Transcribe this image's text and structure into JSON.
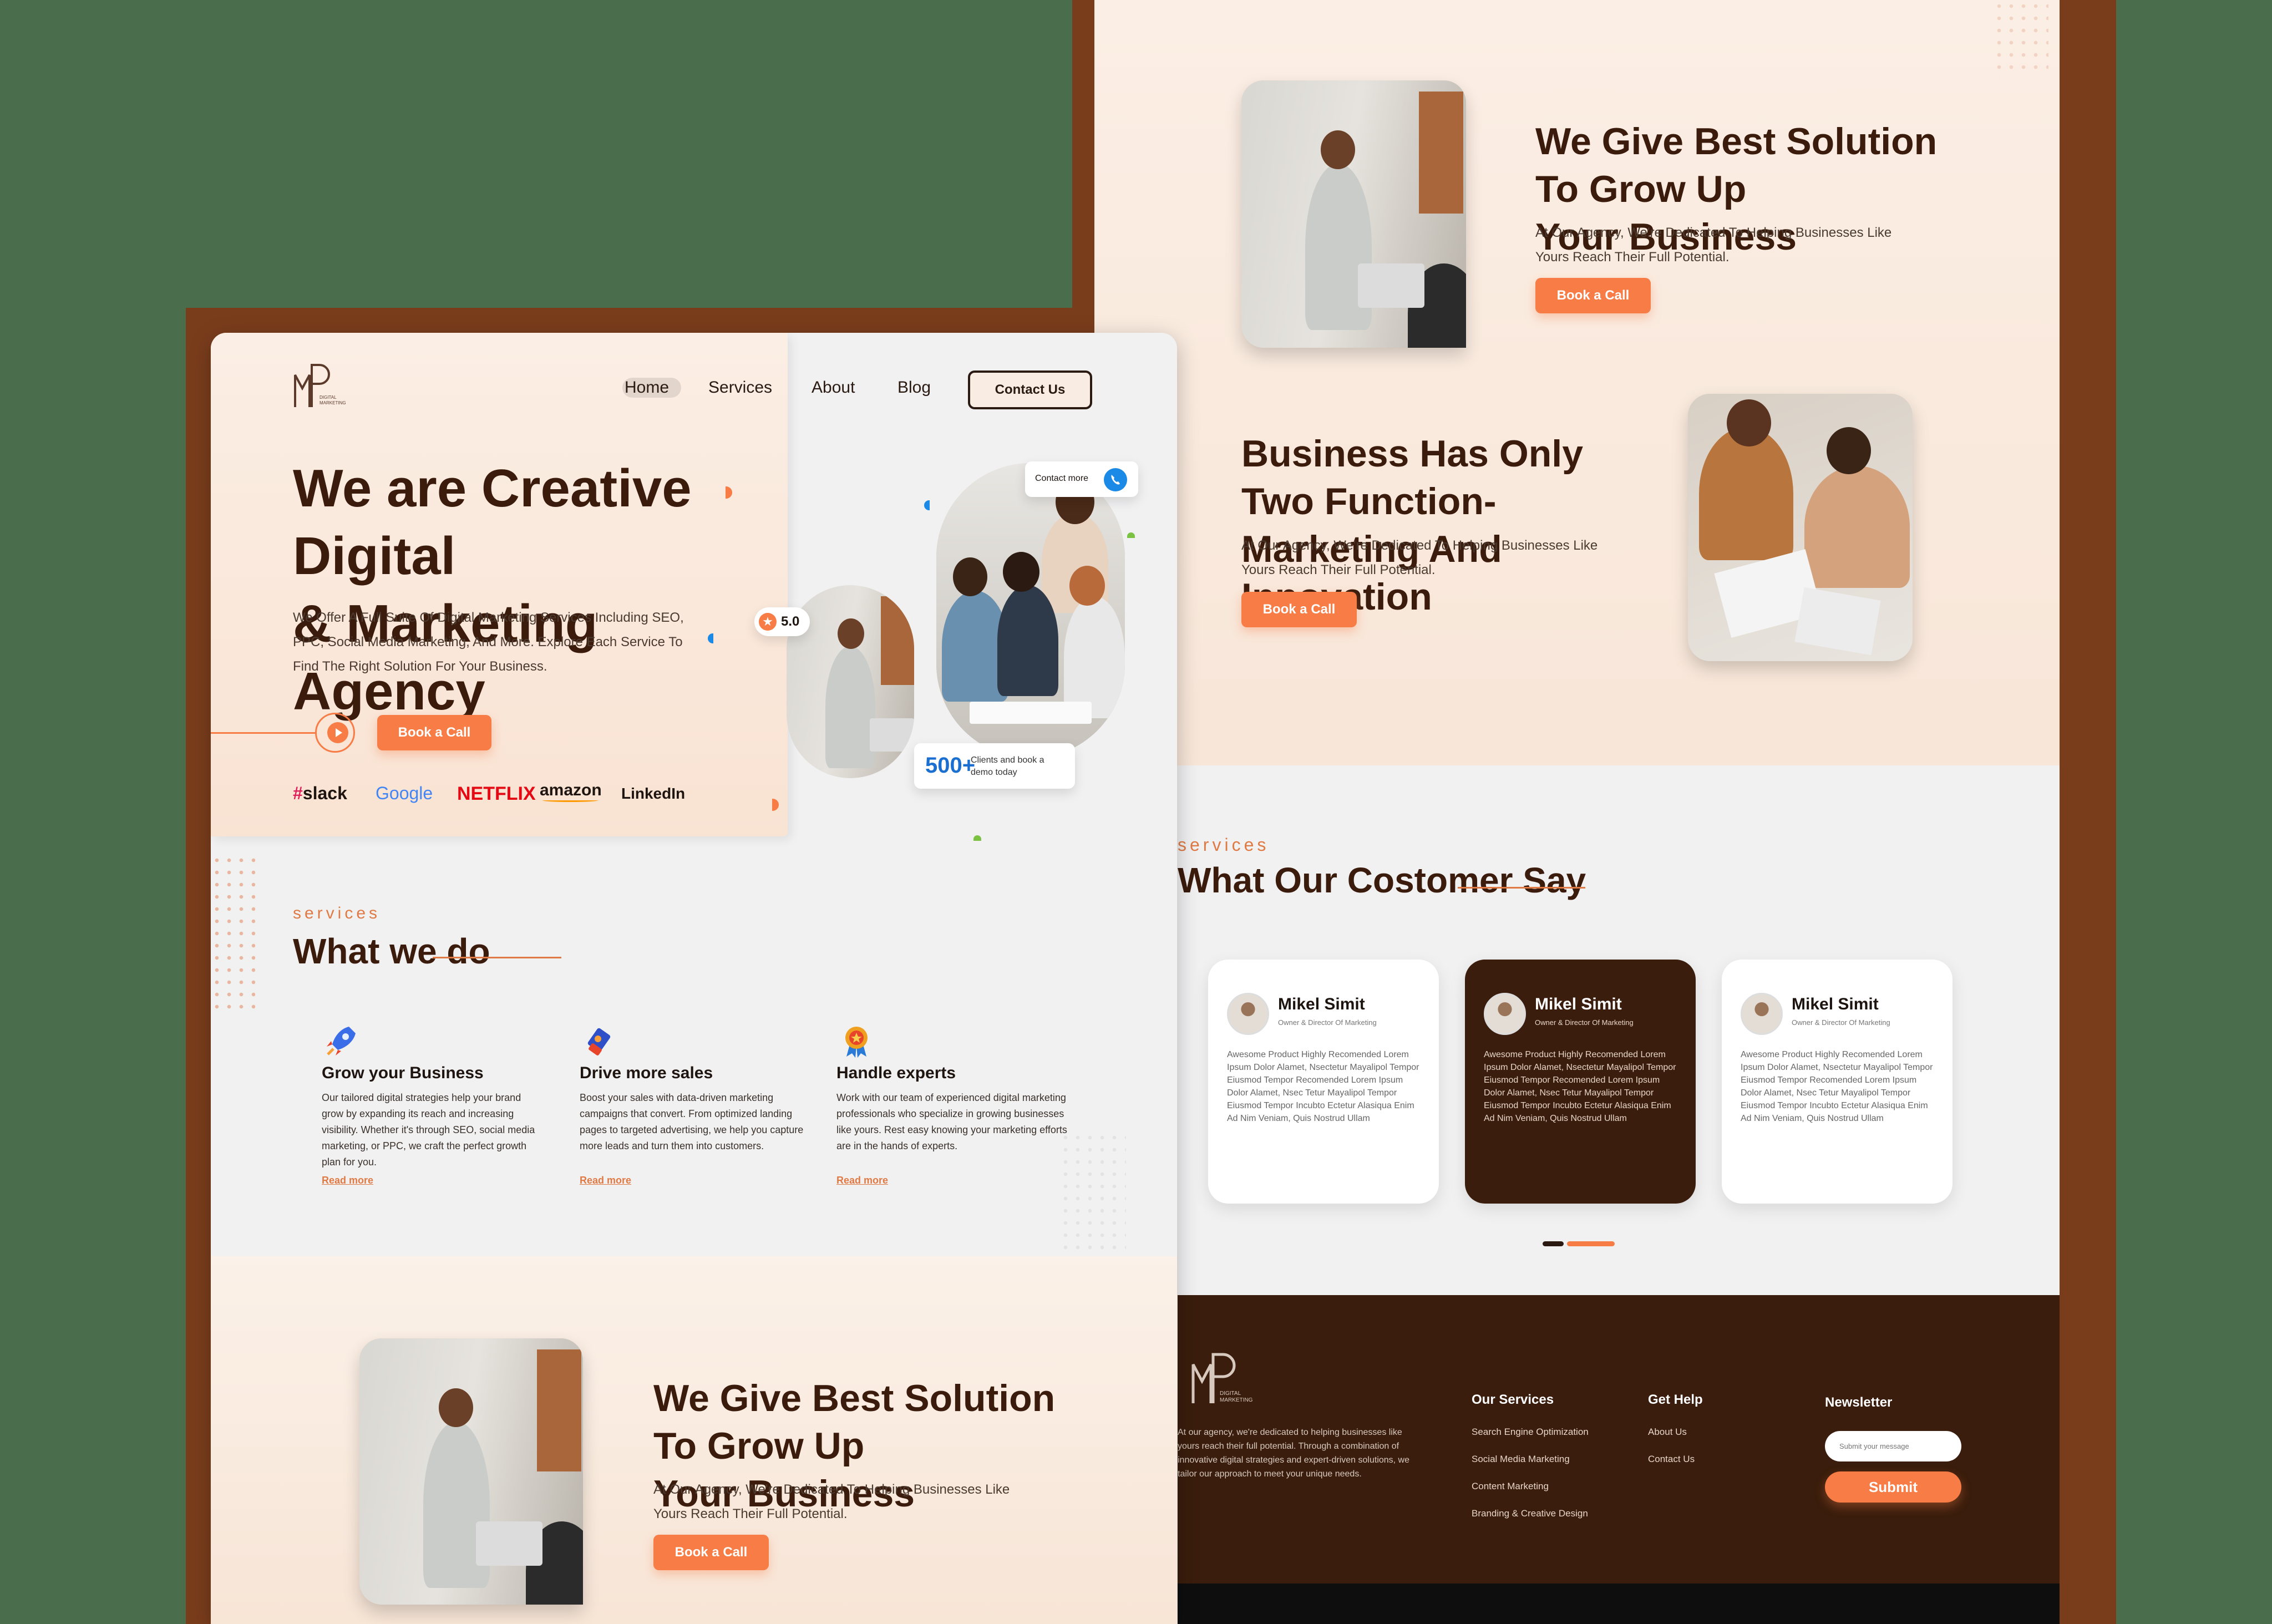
{
  "nav": {
    "items": [
      "Home",
      "Services",
      "About",
      "Blog"
    ],
    "contact_button": "Contact Us"
  },
  "logo": {
    "tagline": "DIGITAL MARKETING"
  },
  "hero": {
    "title_line1": "We are Creative Digital",
    "title_line2": "& Marketing Agency",
    "description": "We Offer A Full Suite Of Digital Marketing Services Including SEO, PPC, Social Media Marketing, And More. Explore Each Service To Find The Right Solution For Your Business.",
    "cta": "Book a Call",
    "rating": "5.0",
    "contact_badge": "Contact more",
    "stat_number": "500+",
    "stat_text": "Clients and book a demo today",
    "brands": [
      "slack",
      "Google",
      "NETFLIX",
      "amazon",
      "LinkedIn"
    ]
  },
  "services": {
    "eyebrow": "services",
    "title": "What we do",
    "items": [
      {
        "title": "Grow your Business",
        "text": "Our tailored digital strategies help your brand grow by expanding its reach and increasing visibility. Whether it's through SEO, social media marketing, or PPC, we craft the perfect growth plan for you.",
        "link": "Read more"
      },
      {
        "title": "Drive more sales",
        "text": "Boost your sales with data-driven marketing campaigns that convert. From optimized landing pages to targeted advertising, we help you capture more leads and turn them into customers.",
        "link": "Read more"
      },
      {
        "title": "Handle experts",
        "text": "Work with our team of experienced digital marketing professionals who specialize in growing businesses like yours. Rest easy knowing your marketing efforts are in the hands of experts.",
        "link": "Read more"
      }
    ]
  },
  "solution": {
    "title_line1": "We Give Best Solution To Grow Up",
    "title_line2": "Your Business",
    "text": "At Our Agency, We're Dedicated To Helping Businesses Like Yours Reach Their Full Potential.",
    "cta": "Book a Call"
  },
  "functions": {
    "title_line1": "Business Has Only Two Function-",
    "title_line2": "Marketing And Innovation",
    "text": "At Our Agency, We're Dedicated To Helping Businesses Like Yours Reach Their Full Potential.",
    "cta": "Book a Call"
  },
  "testimonials": {
    "eyebrow": "services",
    "title": "What Our Costomer Say",
    "items": [
      {
        "name": "Mikel Simit",
        "role": "Owner & Director Of Marketing",
        "text": "Awesome Product Highly Recomended Lorem Ipsum Dolor Alamet, Nsectetur Mayalipol Tempor Eiusmod Tempor Recomended Lorem Ipsum Dolor Alamet, Nsec Tetur Mayalipol Tempor Eiusmod Tempor Incubto Ectetur Alasiqua Enim Ad Nim Veniam, Quis Nostrud Ullam"
      },
      {
        "name": "Mikel Simit",
        "role": "Owner & Director Of Marketing",
        "text": "Awesome Product Highly Recomended Lorem Ipsum Dolor Alamet, Nsectetur Mayalipol Tempor Eiusmod Tempor Recomended Lorem Ipsum Dolor Alamet, Nsec Tetur Mayalipol Tempor Eiusmod Tempor Incubto Ectetur Alasiqua Enim Ad Nim Veniam, Quis Nostrud Ullam"
      },
      {
        "name": "Mikel Simit",
        "role": "Owner & Director Of Marketing",
        "text": "Awesome Product Highly Recomended Lorem Ipsum Dolor Alamet, Nsectetur Mayalipol Tempor Eiusmod Tempor Recomended Lorem Ipsum Dolor Alamet, Nsec Tetur Mayalipol Tempor Eiusmod Tempor Incubto Ectetur Alasiqua Enim Ad Nim Veniam, Quis Nostrud Ullam"
      }
    ]
  },
  "footer": {
    "about": "At our agency, we're dedicated to helping businesses like yours reach their full potential. Through a combination of innovative digital strategies and expert-driven solutions, we tailor our approach to meet your unique needs.",
    "services_title": "Our Services",
    "services": [
      "Search Engine Optimization",
      "Social Media Marketing",
      "Content Marketing",
      "Branding & Creative Design"
    ],
    "help_title": "Get Help",
    "help": [
      "About Us",
      "Contact Us"
    ],
    "newsletter_title": "Newsletter",
    "newsletter_placeholder": "Submit your message",
    "submit": "Submit"
  },
  "colors": {
    "accent": "#f77c45",
    "brown": "#3a1d0c",
    "frame": "#7a3d1c",
    "background": "#4a6e4c"
  }
}
